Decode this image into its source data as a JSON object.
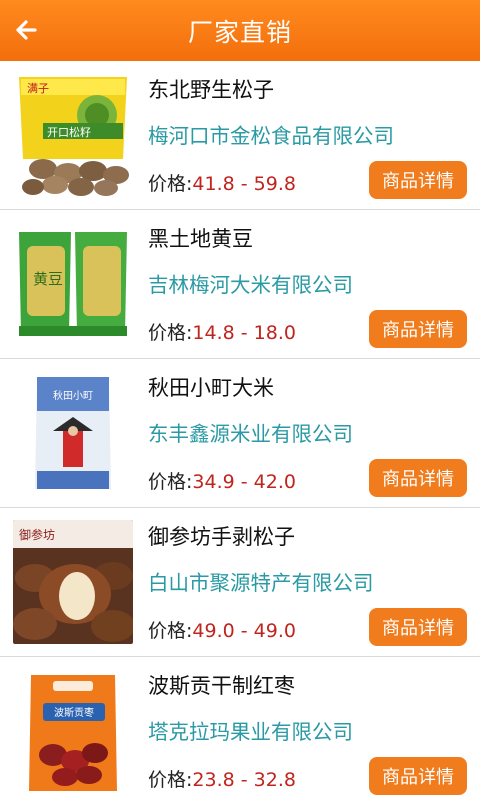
{
  "header": {
    "title": "厂家直销",
    "back_icon": "arrow-left-icon"
  },
  "colors": {
    "accent": "#f07c1d",
    "company": "#2a9aa5",
    "price": "#c0241e"
  },
  "products": [
    {
      "name": "东北野生松子",
      "company": "梅河口市金松食品有限公司",
      "price_label": "价格:",
      "price": "41.8 - 59.8",
      "button": "商品详情",
      "image_text": "满子",
      "image_text_2": "开口松籽"
    },
    {
      "name": "黑土地黄豆",
      "company": "吉林梅河大米有限公司",
      "price_label": "价格:",
      "price": "14.8 - 18.0",
      "button": "商品详情",
      "image_text": "黄豆"
    },
    {
      "name": "秋田小町大米",
      "company": "东丰鑫源米业有限公司",
      "price_label": "价格:",
      "price": "34.9 - 42.0",
      "button": "商品详情",
      "image_text": "秋田小町"
    },
    {
      "name": "御参坊手剥松子",
      "company": "白山市聚源特产有限公司",
      "price_label": "价格:",
      "price": "49.0 - 49.0",
      "button": "商品详情",
      "image_text": "御参坊"
    },
    {
      "name": "波斯贡干制红枣",
      "company": "塔克拉玛果业有限公司",
      "price_label": "价格:",
      "price": "23.8 - 32.8",
      "button": "商品详情",
      "image_text": "波斯贡枣"
    }
  ]
}
